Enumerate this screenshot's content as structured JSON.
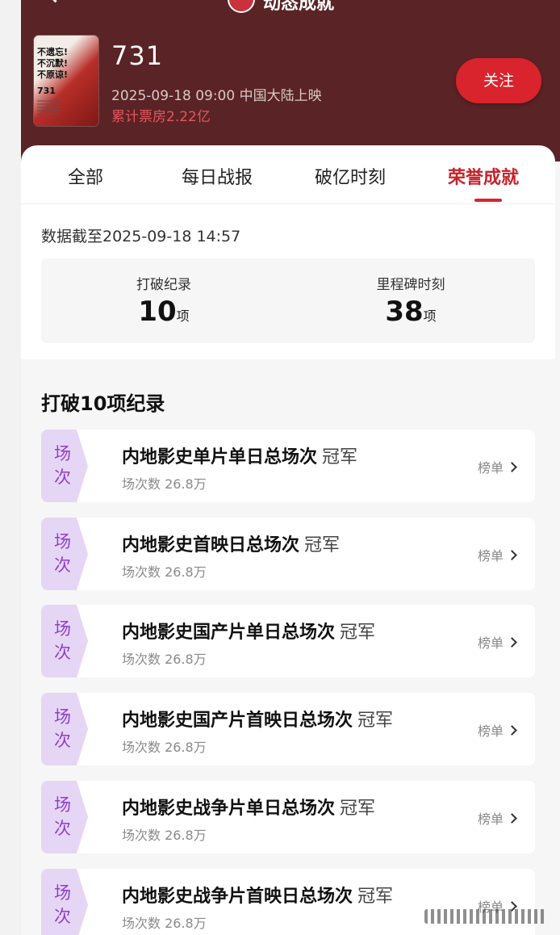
{
  "nav": {
    "title": "动态成就"
  },
  "movie": {
    "poster_text": "不遗忘!不沉默!不原谅!",
    "poster_number": "731",
    "title": "731",
    "release": "2025-09-18 09:00 中国大陆上映",
    "boxoffice_label": "累计票房",
    "boxoffice_value": "2.22亿",
    "follow_label": "关注"
  },
  "tabs": [
    {
      "label": "全部",
      "active": false
    },
    {
      "label": "每日战报",
      "active": false
    },
    {
      "label": "破亿时刻",
      "active": false
    },
    {
      "label": "荣誉成就",
      "active": true
    }
  ],
  "data_time": "数据截至2025-09-18  14:57",
  "stats": [
    {
      "label": "打破纪录",
      "value": "10",
      "unit": "项"
    },
    {
      "label": "里程碑时刻",
      "value": "38",
      "unit": "项"
    }
  ],
  "records_section_title": "打破10项纪录",
  "records": [
    {
      "tag": "场次",
      "title": "内地影史单片单日总场次",
      "rank": "冠军",
      "sub": "场次数 26.8万",
      "link": "榜单"
    },
    {
      "tag": "场次",
      "title": "内地影史首映日总场次",
      "rank": "冠军",
      "sub": "场次数 26.8万",
      "link": "榜单"
    },
    {
      "tag": "场次",
      "title": "内地影史国产片单日总场次",
      "rank": "冠军",
      "sub": "场次数 26.8万",
      "link": "榜单"
    },
    {
      "tag": "场次",
      "title": "内地影史国产片首映日总场次",
      "rank": "冠军",
      "sub": "场次数 26.8万",
      "link": "榜单"
    },
    {
      "tag": "场次",
      "title": "内地影史战争片单日总场次",
      "rank": "冠军",
      "sub": "场次数 26.8万",
      "link": "榜单"
    },
    {
      "tag": "场次",
      "title": "内地影史战争片首映日总场次",
      "rank": "冠军",
      "sub": "场次数 26.8万",
      "link": "榜单"
    }
  ],
  "colors": {
    "header_bg": "#5a2325",
    "accent_red": "#d9232d",
    "tag_bg": "#e5d6f6",
    "tag_text": "#8f3fc8"
  }
}
